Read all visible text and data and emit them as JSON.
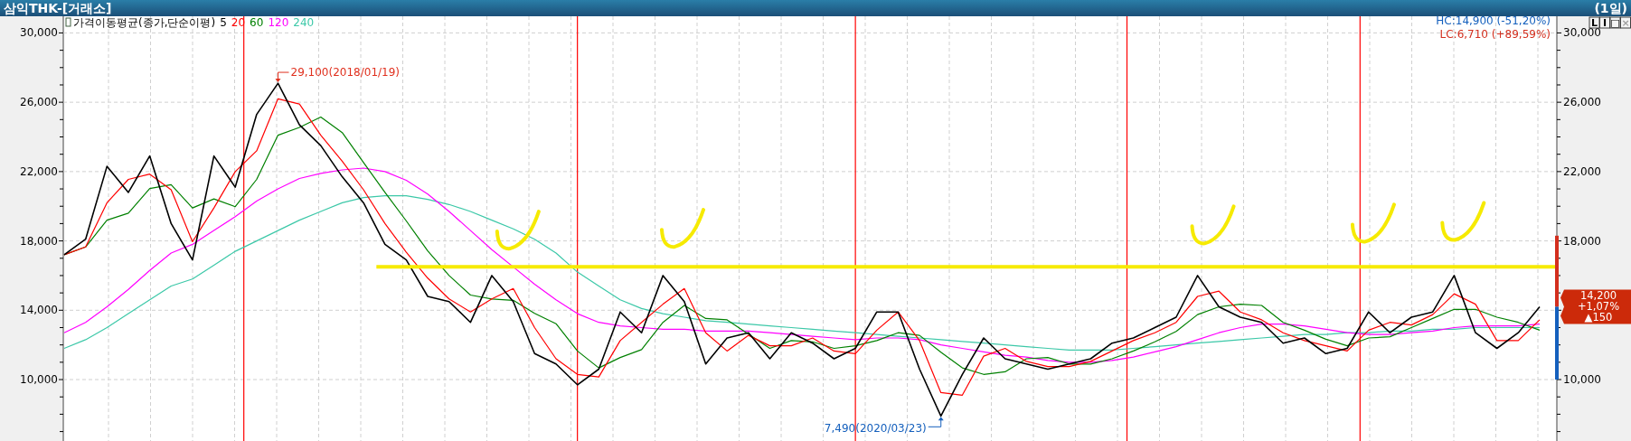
{
  "window": {
    "title": "삼익THK-[거래소]",
    "period": "(1일)"
  },
  "legend": {
    "title": "가격이동평균(종가,단순이평)"
  },
  "hc": "HC:14,900 (-51,20%)",
  "lc": "LC:6,710 (+89,59%)",
  "high_label": "29,100(2018/01/19)",
  "low_label": "7,490(2020/03/23)",
  "toolbar": [
    {
      "label": "L",
      "disabled": false
    },
    {
      "label": "I",
      "disabled": false
    },
    {
      "label": "□",
      "disabled": false
    },
    {
      "label": "×",
      "disabled": true
    }
  ],
  "price_tag": {
    "price": "14,200",
    "change": "+1,07%",
    "delta": "▲150"
  },
  "chart_data": {
    "type": "line",
    "grid": true,
    "ylim": [
      6456,
      30961
    ],
    "yticks": [
      {
        "value": 30000,
        "label": "30,000"
      },
      {
        "value": 26000,
        "label": "26,000"
      },
      {
        "value": 22000,
        "label": "22,000"
      },
      {
        "value": 18000,
        "label": "18,000"
      },
      {
        "value": 14000,
        "label": "14,000"
      },
      {
        "value": 10000,
        "label": "10,000"
      }
    ],
    "categories": [
      null,
      null,
      null,
      null,
      null,
      null,
      null,
      null,
      null,
      null,
      null,
      null,
      null,
      null,
      null,
      null,
      null,
      null,
      null,
      null,
      null,
      null,
      null,
      null,
      null,
      null,
      null,
      null,
      null,
      null,
      null,
      null,
      null,
      null,
      null,
      null,
      null,
      null,
      null,
      null,
      null,
      null,
      null,
      null,
      null,
      null,
      null,
      null,
      null,
      null,
      null,
      null,
      null,
      null,
      null,
      null,
      null,
      null,
      null,
      null,
      null,
      null,
      null,
      null,
      null,
      null,
      null,
      null,
      null,
      null
    ],
    "series": [
      {
        "name": "5",
        "color": "#000000",
        "values": [
          17200,
          18100,
          22300,
          20800,
          22900,
          19000,
          16900,
          22900,
          21100,
          25300,
          27100,
          24700,
          23500,
          21700,
          20200,
          17800,
          16900,
          14800,
          14500,
          13300,
          16000,
          14500,
          11500,
          10900,
          9700,
          10600,
          13900,
          12700,
          16000,
          14500,
          10900,
          12400,
          12700,
          11200,
          12700,
          12100,
          11200,
          11800,
          13900,
          13900,
          10600,
          7900,
          10300,
          12400,
          11200,
          10900,
          10600,
          10900,
          11200,
          12100,
          12400,
          13000,
          13600,
          16000,
          14200,
          13600,
          13300,
          12100,
          12400,
          11500,
          11800,
          13900,
          12700,
          13600,
          13900,
          16000,
          12700,
          11800,
          12700,
          14200
        ]
      },
      {
        "name": "20",
        "color": "#ff0000",
        "values": [
          17200,
          17650,
          20200,
          21550,
          21850,
          20950,
          17950,
          19900,
          22000,
          23200,
          26200,
          25900,
          24100,
          22600,
          20950,
          19000,
          17350,
          15850,
          14650,
          13900,
          14650,
          15250,
          13000,
          11200,
          10300,
          10150,
          12250,
          13300,
          14350,
          15250,
          12700,
          11650,
          12550,
          11950,
          11950,
          12400,
          11650,
          11500,
          12850,
          13900,
          12250,
          9250,
          9100,
          11350,
          11800,
          11050,
          10750,
          10750,
          11050,
          11650,
          12250,
          12700,
          13300,
          14800,
          15100,
          13900,
          13450,
          12700,
          12250,
          11950,
          11650,
          12850,
          13300,
          13150,
          13750,
          14950,
          14350,
          12250,
          12250,
          13450
        ]
      },
      {
        "name": "60",
        "color": "#008000",
        "values": [
          17200,
          17650,
          19200,
          19600,
          21025,
          21250,
          19900,
          20425,
          19975,
          21550,
          24100,
          24550,
          25150,
          24250,
          22525,
          20800,
          19150,
          17425,
          16000,
          14875,
          14650,
          14575,
          13825,
          13225,
          11650,
          10675,
          11275,
          11725,
          13300,
          14275,
          13525,
          13450,
          12625,
          11800,
          12250,
          12175,
          11800,
          11950,
          12250,
          12700,
          12550,
          11575,
          10675,
          10300,
          10450,
          11200,
          11275,
          10900,
          10900,
          11200,
          11650,
          12175,
          12775,
          13750,
          14200,
          14350,
          14275,
          13300,
          12850,
          12325,
          11950,
          12400,
          12475,
          13000,
          13525,
          14050,
          14050,
          13600,
          13300,
          12850
        ]
      },
      {
        "name": "120",
        "color": "#ff00ff",
        "values": [
          12700,
          13300,
          14200,
          15200,
          16300,
          17300,
          17800,
          18600,
          19400,
          20300,
          21000,
          21600,
          21900,
          22100,
          22200,
          22000,
          21500,
          20700,
          19700,
          18600,
          17500,
          16500,
          15500,
          14600,
          13800,
          13300,
          13100,
          13000,
          12900,
          12900,
          12800,
          12800,
          12800,
          12700,
          12600,
          12500,
          12400,
          12300,
          12400,
          12400,
          12300,
          12000,
          11800,
          11600,
          11400,
          11300,
          11100,
          11000,
          11000,
          11100,
          11300,
          11600,
          11900,
          12300,
          12700,
          13000,
          13200,
          13200,
          13100,
          12900,
          12700,
          12600,
          12600,
          12700,
          12800,
          13000,
          13100,
          13100,
          13100,
          13200
        ]
      },
      {
        "name": "240",
        "color": "#3cc8a8",
        "values": [
          11800,
          12300,
          13000,
          13800,
          14600,
          15400,
          15800,
          16600,
          17400,
          18000,
          18600,
          19200,
          19700,
          20200,
          20500,
          20600,
          20600,
          20400,
          20100,
          19700,
          19200,
          18700,
          18100,
          17300,
          16200,
          15400,
          14600,
          14100,
          13800,
          13600,
          13400,
          13300,
          13200,
          13100,
          13000,
          12900,
          12800,
          12700,
          12600,
          12500,
          12400,
          12300,
          12200,
          12100,
          12000,
          11900,
          11800,
          11700,
          11700,
          11700,
          11800,
          11900,
          12000,
          12100,
          12200,
          12300,
          12400,
          12500,
          12600,
          12600,
          12700,
          12700,
          12800,
          12800,
          12900,
          12900,
          13000,
          13000,
          13000,
          13000
        ]
      }
    ]
  }
}
